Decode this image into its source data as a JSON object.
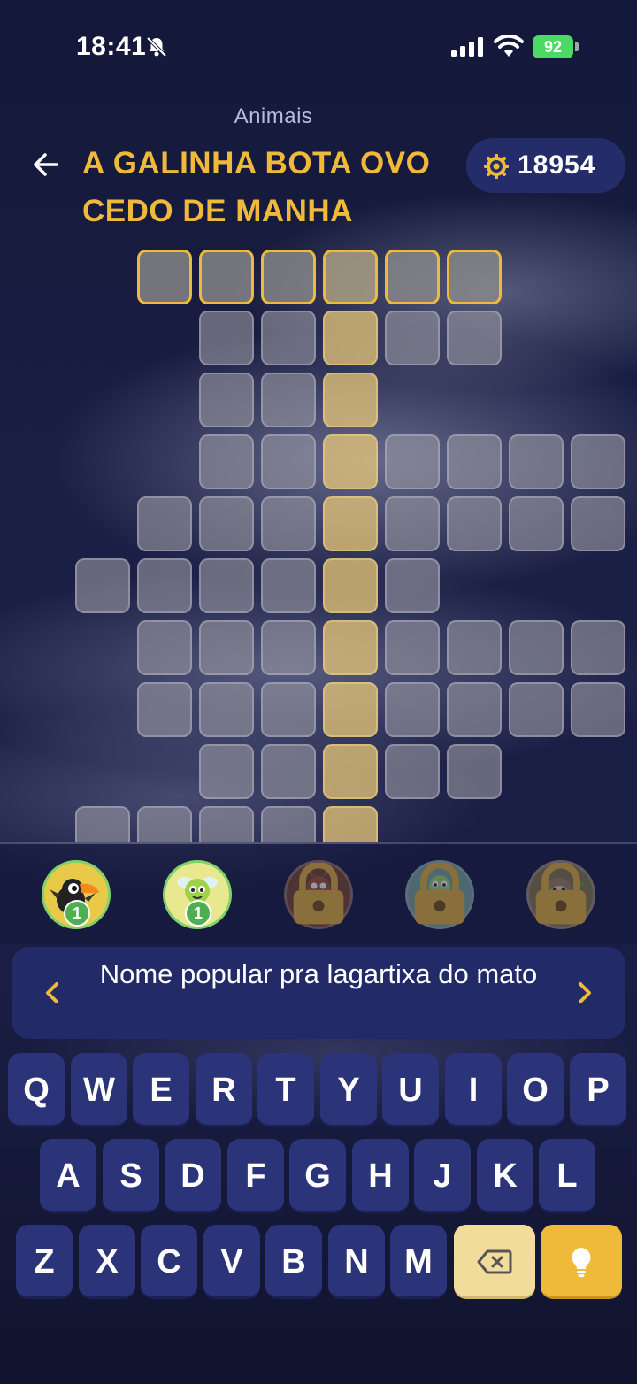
{
  "status_bar": {
    "time": "18:41",
    "battery": "92",
    "icons": [
      "bell-slash-icon",
      "signal-icon",
      "wifi-icon",
      "battery-icon"
    ]
  },
  "header": {
    "category": "Animais",
    "title": "A GALINHA BOTA OVO CEDO DE MANHA",
    "coins": "18954",
    "back_icon": "arrow-left-icon",
    "coin_icon": "gear-coin-icon"
  },
  "colors": {
    "accent": "#efb93a",
    "background": "#15193a",
    "key": "#2c3479",
    "clue_bg": "#222a68",
    "unlocked_ring": "#7fd16a"
  },
  "characters": [
    {
      "name": "toucan",
      "badge": "1",
      "locked": false
    },
    {
      "name": "bee",
      "badge": "1",
      "locked": false
    },
    {
      "name": "ant",
      "locked": true
    },
    {
      "name": "turtle",
      "locked": true
    },
    {
      "name": "sloth",
      "locked": true
    }
  ],
  "clue": {
    "text": "Nome popular pra lagartixa do mato",
    "prev_icon": "chevron-left-icon",
    "next_icon": "chevron-right-icon"
  },
  "keyboard": {
    "rows": [
      [
        "Q",
        "W",
        "E",
        "R",
        "T",
        "Y",
        "U",
        "I",
        "O",
        "P"
      ],
      [
        "A",
        "S",
        "D",
        "F",
        "G",
        "H",
        "J",
        "K",
        "L"
      ],
      [
        "Z",
        "X",
        "C",
        "V",
        "B",
        "N",
        "M"
      ]
    ],
    "delete_icon": "backspace-icon",
    "hint_icon": "lightbulb-icon"
  }
}
